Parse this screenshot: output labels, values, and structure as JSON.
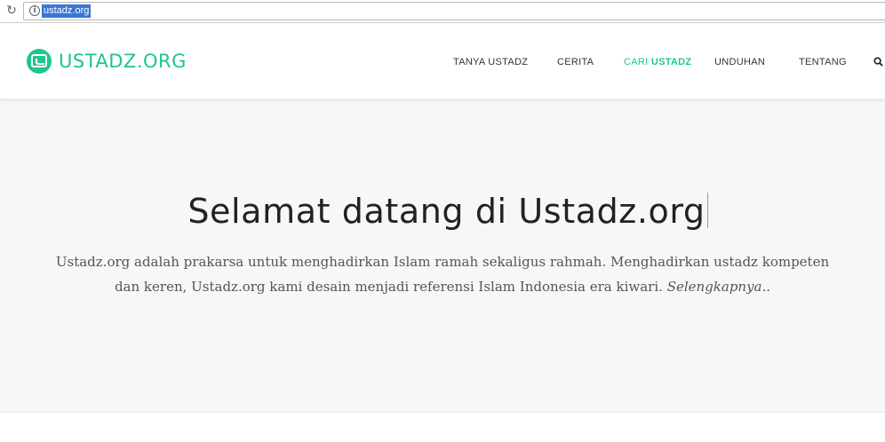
{
  "browser": {
    "url": "ustadz.org",
    "reload_icon": "↻",
    "info_icon": "i"
  },
  "header": {
    "logo_text": "USTADZ.ORG",
    "brand_color": "#1fc68a",
    "nav": [
      {
        "label": "TANYA USTADZ",
        "active": false
      },
      {
        "label": "CERITA",
        "active": false
      },
      {
        "label_prefix": "CARI ",
        "label_bold": "USTADZ",
        "active": true
      },
      {
        "label": "UNDUHAN",
        "active": false
      },
      {
        "label": "TENTANG",
        "active": false
      }
    ],
    "search_icon": "search-icon"
  },
  "hero": {
    "title": "Selamat datang di Ustadz.org",
    "description": "Ustadz.org adalah prakarsa untuk menghadirkan Islam ramah sekaligus rahmah. Menghadirkan ustadz kompeten dan keren, Ustadz.org kami desain menjadi referensi Islam Indonesia era kiwari.",
    "more_link": "Selengkapnya.."
  }
}
